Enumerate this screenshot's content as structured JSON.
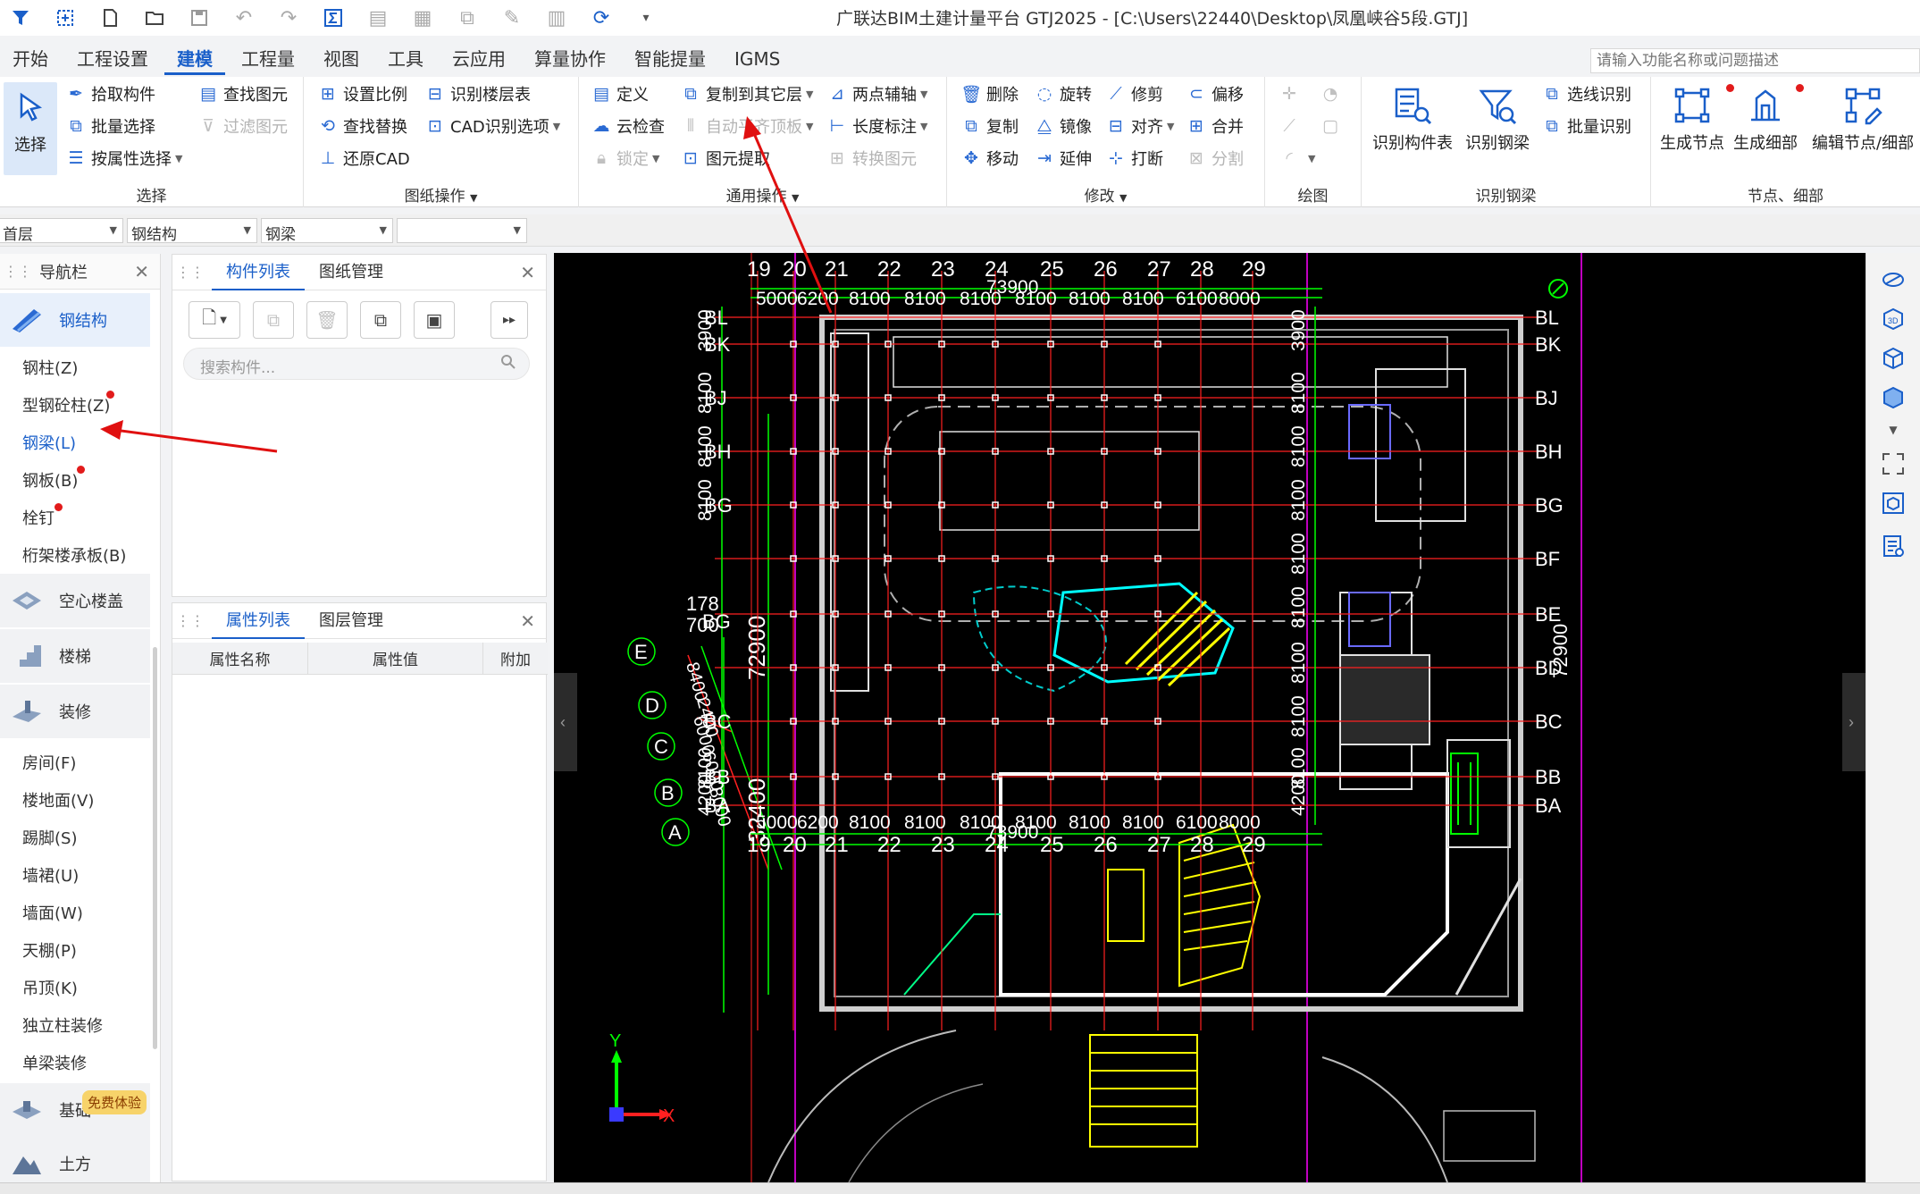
{
  "titlebar": {
    "title": "广联达BIM土建计量平台 GTJ2025 - [C:\\Users\\22440\\Desktop\\凤凰峡谷5段.GTJ]",
    "quick_access_icons": [
      "app-logo-icon",
      "snap-icon",
      "new-file-icon",
      "open-folder-icon",
      "save-icon",
      "undo-icon",
      "redo-icon",
      "sum-icon",
      "report-icon",
      "table-icon",
      "copy-doc-icon",
      "pen-icon",
      "ruler-icon",
      "refresh-icon",
      "customize-icon"
    ]
  },
  "tabs": [
    "开始",
    "工程设置",
    "建模",
    "工程量",
    "视图",
    "工具",
    "云应用",
    "算量协作",
    "智能提量",
    "IGMS"
  ],
  "active_tab": "建模",
  "search": {
    "placeholder": "请输入功能名称或问题描述"
  },
  "ribbon": {
    "select": {
      "button": "选择",
      "label": "选择",
      "items": [
        "拾取构件",
        "批量选择",
        "按属性选择",
        "查找图元",
        "过滤图元"
      ]
    },
    "drawing_ops": {
      "label": "图纸操作",
      "items": [
        "设置比例",
        "查找替换",
        "还原CAD",
        "识别楼层表",
        "CAD识别选项"
      ]
    },
    "general_ops": {
      "label": "通用操作",
      "items": [
        "定义",
        "云检查",
        "锁定",
        "复制到其它层",
        "自动平齐顶板",
        "图元提取",
        "两点辅轴",
        "长度标注",
        "转换图元"
      ]
    },
    "modify": {
      "label": "修改",
      "items": [
        "删除",
        "复制",
        "移动",
        "旋转",
        "镜像",
        "延伸",
        "修剪",
        "对齐",
        "打断",
        "偏移",
        "合并",
        "分割"
      ]
    },
    "draw": {
      "label": "绘图"
    },
    "recognize_steel_beam": {
      "label": "识别钢梁",
      "items": [
        "识别构件表",
        "识别钢梁",
        "选线识别",
        "批量识别"
      ]
    },
    "nodes": {
      "label": "节点、细部",
      "items": [
        "生成节点",
        "生成细部",
        "编辑节点/细部"
      ]
    }
  },
  "selectors": [
    "首层",
    "钢结构",
    "钢梁",
    ""
  ],
  "nav": {
    "title": "导航栏",
    "categories": [
      {
        "label": "钢结构",
        "active": true
      },
      {
        "label": "空心楼盖"
      },
      {
        "label": "楼梯"
      },
      {
        "label": "装修"
      },
      {
        "label": "基础"
      },
      {
        "label": "土方"
      }
    ],
    "steel_items": [
      "钢柱(Z)",
      "型钢砼柱(Z)",
      "钢梁(L)",
      "钢板(B)",
      "栓钉",
      "桁架楼承板(B)"
    ],
    "active_item": "钢梁(L)",
    "decor_items": [
      "房间(F)",
      "楼地面(V)",
      "踢脚(S)",
      "墙裙(U)",
      "墙面(W)",
      "天棚(P)",
      "吊顶(K)",
      "独立柱装修",
      "单梁装修"
    ],
    "free_badge": "免费体验"
  },
  "component_panel": {
    "tabs": [
      "构件列表",
      "图纸管理"
    ],
    "search_placeholder": "搜索构件..."
  },
  "property_panel": {
    "tabs": [
      "属性列表",
      "图层管理"
    ],
    "columns": [
      "属性名称",
      "属性值",
      "附加"
    ]
  },
  "cad": {
    "axis_numbers": [
      "19",
      "20",
      "21",
      "22",
      "23",
      "24",
      "25",
      "26",
      "27",
      "28",
      "29"
    ],
    "axis_letters_right": [
      "BL",
      "BK",
      "BJ",
      "BH",
      "BG",
      "BF",
      "BE",
      "BD",
      "BC",
      "BB",
      "BA"
    ],
    "axis_letters_left": [
      "BL",
      "BK",
      "BJ",
      "BH",
      "BG",
      "BC",
      "BB",
      "BA"
    ],
    "spans_top": [
      "5000",
      "6200",
      "8100",
      "8100",
      "8100",
      "8100",
      "8100",
      "8100",
      "6100",
      "8000"
    ],
    "total_width": "73900",
    "spans_right": [
      "3900",
      "8100",
      "8100",
      "8100",
      "8100",
      "8100",
      "8100",
      "8100",
      "8100",
      "4200"
    ],
    "left_dims": [
      "3900",
      "8100",
      "8100",
      "8100",
      "72900",
      "32400",
      "8100",
      "4200"
    ],
    "side_axes": [
      "E",
      "D",
      "C",
      "B",
      "A"
    ],
    "side_dims": [
      "8400",
      "6000",
      "6000",
      "8000",
      "2400"
    ],
    "misc_labels": [
      "178",
      "700",
      "BG"
    ],
    "ucs_labels": [
      "Y",
      "X"
    ],
    "colors": {
      "grid": "#ff2020",
      "dim": "#00ff00",
      "wall": "#ffffff",
      "stair": "#ffff00",
      "cyan": "#00ffff",
      "magenta": "#ff00ff"
    }
  }
}
